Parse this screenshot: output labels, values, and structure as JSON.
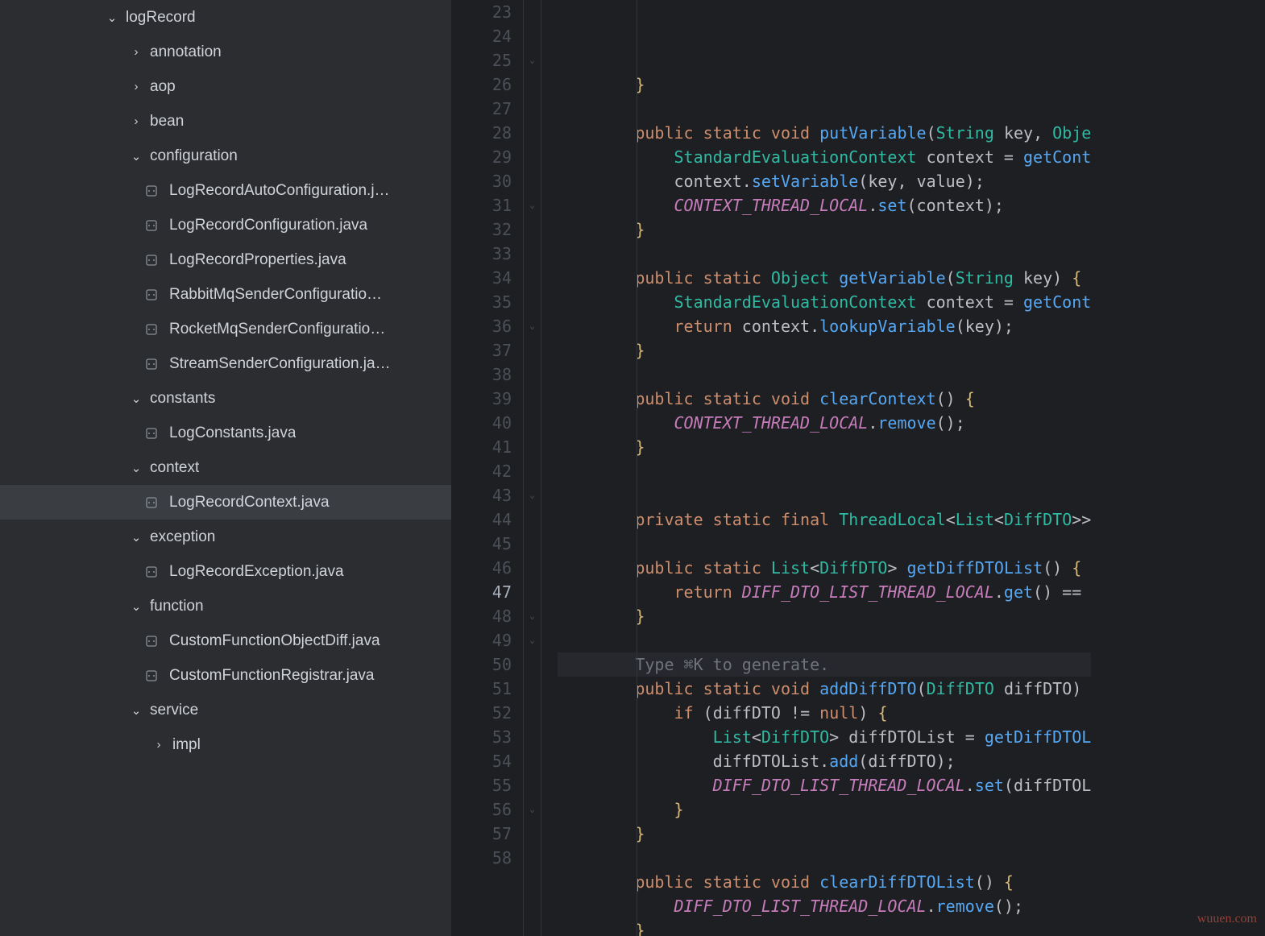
{
  "sidebar": {
    "root": "logRecord",
    "folders": {
      "annotation": "annotation",
      "aop": "aop",
      "bean": "bean",
      "configuration": "configuration",
      "constants": "constants",
      "context": "context",
      "exception": "exception",
      "function": "function",
      "service": "service",
      "impl": "impl"
    },
    "files": {
      "cfg1": "LogRecordAutoConfiguration.j…",
      "cfg2": "LogRecordConfiguration.java",
      "cfg3": "LogRecordProperties.java",
      "cfg4": "RabbitMqSenderConfiguratio…",
      "cfg5": "RocketMqSenderConfiguratio…",
      "cfg6": "StreamSenderConfiguration.ja…",
      "const1": "LogConstants.java",
      "ctx1": "LogRecordContext.java",
      "exc1": "LogRecordException.java",
      "fn1": "CustomFunctionObjectDiff.java",
      "fn2": "CustomFunctionRegistrar.java"
    }
  },
  "editor": {
    "lines_start": 23,
    "lines_end": 58,
    "current_line": 47,
    "foldable": [
      25,
      31,
      36,
      43,
      48,
      49,
      56
    ],
    "hint_text": "Type ⌘K to generate.",
    "code": [
      [
        [
          "curly",
          "        }"
        ]
      ],
      [],
      [
        [
          "ws",
          "        "
        ],
        [
          "kw",
          "public"
        ],
        [
          "ws",
          " "
        ],
        [
          "kw",
          "static"
        ],
        [
          "ws",
          " "
        ],
        [
          "kw",
          "void"
        ],
        [
          "ws",
          " "
        ],
        [
          "m",
          "putVariable"
        ],
        [
          "p",
          "("
        ],
        [
          "cls",
          "String"
        ],
        [
          "ws",
          " "
        ],
        [
          "id",
          "key"
        ],
        [
          "p",
          ", "
        ],
        [
          "cls",
          "Obje"
        ]
      ],
      [
        [
          "ws",
          "            "
        ],
        [
          "cls",
          "StandardEvaluationContext"
        ],
        [
          "ws",
          " "
        ],
        [
          "id",
          "context"
        ],
        [
          "ws",
          " "
        ],
        [
          "p",
          "="
        ],
        [
          "ws",
          " "
        ],
        [
          "m",
          "getCont"
        ]
      ],
      [
        [
          "ws",
          "            "
        ],
        [
          "id",
          "context"
        ],
        [
          "p",
          "."
        ],
        [
          "m",
          "setVariable"
        ],
        [
          "p",
          "("
        ],
        [
          "id",
          "key"
        ],
        [
          "p",
          ", "
        ],
        [
          "id",
          "value"
        ],
        [
          "p",
          ");"
        ]
      ],
      [
        [
          "ws",
          "            "
        ],
        [
          "cnst",
          "CONTEXT_THREAD_LOCAL"
        ],
        [
          "p",
          "."
        ],
        [
          "m",
          "set"
        ],
        [
          "p",
          "("
        ],
        [
          "id",
          "context"
        ],
        [
          "p",
          ");"
        ]
      ],
      [
        [
          "ws",
          "        "
        ],
        [
          "curly",
          "}"
        ]
      ],
      [],
      [
        [
          "ws",
          "        "
        ],
        [
          "kw",
          "public"
        ],
        [
          "ws",
          " "
        ],
        [
          "kw",
          "static"
        ],
        [
          "ws",
          " "
        ],
        [
          "cls",
          "Object"
        ],
        [
          "ws",
          " "
        ],
        [
          "m",
          "getVariable"
        ],
        [
          "p",
          "("
        ],
        [
          "cls",
          "String"
        ],
        [
          "ws",
          " "
        ],
        [
          "id",
          "key"
        ],
        [
          "p",
          ") "
        ],
        [
          "curly",
          "{"
        ]
      ],
      [
        [
          "ws",
          "            "
        ],
        [
          "cls",
          "StandardEvaluationContext"
        ],
        [
          "ws",
          " "
        ],
        [
          "id",
          "context"
        ],
        [
          "ws",
          " "
        ],
        [
          "p",
          "="
        ],
        [
          "ws",
          " "
        ],
        [
          "m",
          "getCont"
        ]
      ],
      [
        [
          "ws",
          "            "
        ],
        [
          "kw",
          "return"
        ],
        [
          "ws",
          " "
        ],
        [
          "id",
          "context"
        ],
        [
          "p",
          "."
        ],
        [
          "m",
          "lookupVariable"
        ],
        [
          "p",
          "("
        ],
        [
          "id",
          "key"
        ],
        [
          "p",
          ");"
        ]
      ],
      [
        [
          "ws",
          "        "
        ],
        [
          "curly",
          "}"
        ]
      ],
      [],
      [
        [
          "ws",
          "        "
        ],
        [
          "kw",
          "public"
        ],
        [
          "ws",
          " "
        ],
        [
          "kw",
          "static"
        ],
        [
          "ws",
          " "
        ],
        [
          "kw",
          "void"
        ],
        [
          "ws",
          " "
        ],
        [
          "m",
          "clearContext"
        ],
        [
          "p",
          "() "
        ],
        [
          "curly",
          "{"
        ]
      ],
      [
        [
          "ws",
          "            "
        ],
        [
          "cnst",
          "CONTEXT_THREAD_LOCAL"
        ],
        [
          "p",
          "."
        ],
        [
          "m",
          "remove"
        ],
        [
          "p",
          "();"
        ]
      ],
      [
        [
          "ws",
          "        "
        ],
        [
          "curly",
          "}"
        ]
      ],
      [],
      [],
      [
        [
          "ws",
          "        "
        ],
        [
          "kw",
          "private"
        ],
        [
          "ws",
          " "
        ],
        [
          "kw",
          "static"
        ],
        [
          "ws",
          " "
        ],
        [
          "kw",
          "final"
        ],
        [
          "ws",
          " "
        ],
        [
          "cls",
          "ThreadLocal"
        ],
        [
          "p",
          "<"
        ],
        [
          "cls",
          "List"
        ],
        [
          "p",
          "<"
        ],
        [
          "cls",
          "DiffDTO"
        ],
        [
          "p",
          ">>"
        ]
      ],
      [],
      [
        [
          "ws",
          "        "
        ],
        [
          "kw",
          "public"
        ],
        [
          "ws",
          " "
        ],
        [
          "kw",
          "static"
        ],
        [
          "ws",
          " "
        ],
        [
          "cls",
          "List"
        ],
        [
          "p",
          "<"
        ],
        [
          "cls",
          "DiffDTO"
        ],
        [
          "p",
          "> "
        ],
        [
          "m",
          "getDiffDTOList"
        ],
        [
          "p",
          "() "
        ],
        [
          "curly",
          "{"
        ]
      ],
      [
        [
          "ws",
          "            "
        ],
        [
          "kw",
          "return"
        ],
        [
          "ws",
          " "
        ],
        [
          "cnst",
          "DIFF_DTO_LIST_THREAD_LOCAL"
        ],
        [
          "p",
          "."
        ],
        [
          "m",
          "get"
        ],
        [
          "p",
          "() "
        ],
        [
          "p",
          "=="
        ]
      ],
      [
        [
          "ws",
          "        "
        ],
        [
          "curly",
          "}"
        ]
      ],
      [],
      [
        [
          "hint",
          "        Type ⌘K to generate."
        ]
      ],
      [
        [
          "ws",
          "        "
        ],
        [
          "kw",
          "public"
        ],
        [
          "ws",
          " "
        ],
        [
          "kw",
          "static"
        ],
        [
          "ws",
          " "
        ],
        [
          "kw",
          "void"
        ],
        [
          "ws",
          " "
        ],
        [
          "m",
          "addDiffDTO"
        ],
        [
          "p",
          "("
        ],
        [
          "cls",
          "DiffDTO"
        ],
        [
          "ws",
          " "
        ],
        [
          "id",
          "diffDTO"
        ],
        [
          "p",
          ")"
        ]
      ],
      [
        [
          "ws",
          "            "
        ],
        [
          "kw",
          "if"
        ],
        [
          "ws",
          " "
        ],
        [
          "p",
          "("
        ],
        [
          "id",
          "diffDTO"
        ],
        [
          "ws",
          " "
        ],
        [
          "p",
          "!="
        ],
        [
          "ws",
          " "
        ],
        [
          "nl",
          "null"
        ],
        [
          "p",
          ") "
        ],
        [
          "curly",
          "{"
        ]
      ],
      [
        [
          "ws",
          "                "
        ],
        [
          "cls",
          "List"
        ],
        [
          "p",
          "<"
        ],
        [
          "cls",
          "DiffDTO"
        ],
        [
          "p",
          "> "
        ],
        [
          "id",
          "diffDTOList"
        ],
        [
          "ws",
          " "
        ],
        [
          "p",
          "="
        ],
        [
          "ws",
          " "
        ],
        [
          "m",
          "getDiffDTOL"
        ]
      ],
      [
        [
          "ws",
          "                "
        ],
        [
          "id",
          "diffDTOList"
        ],
        [
          "p",
          "."
        ],
        [
          "m",
          "add"
        ],
        [
          "p",
          "("
        ],
        [
          "id",
          "diffDTO"
        ],
        [
          "p",
          ");"
        ]
      ],
      [
        [
          "ws",
          "                "
        ],
        [
          "cnst",
          "DIFF_DTO_LIST_THREAD_LOCAL"
        ],
        [
          "p",
          "."
        ],
        [
          "m",
          "set"
        ],
        [
          "p",
          "("
        ],
        [
          "id",
          "diffDTOL"
        ]
      ],
      [
        [
          "ws",
          "            "
        ],
        [
          "curly",
          "}"
        ]
      ],
      [
        [
          "ws",
          "        "
        ],
        [
          "curly",
          "}"
        ]
      ],
      [],
      [
        [
          "ws",
          "        "
        ],
        [
          "kw",
          "public"
        ],
        [
          "ws",
          " "
        ],
        [
          "kw",
          "static"
        ],
        [
          "ws",
          " "
        ],
        [
          "kw",
          "void"
        ],
        [
          "ws",
          " "
        ],
        [
          "m",
          "clearDiffDTOList"
        ],
        [
          "p",
          "() "
        ],
        [
          "curly",
          "{"
        ]
      ],
      [
        [
          "ws",
          "            "
        ],
        [
          "cnst",
          "DIFF_DTO_LIST_THREAD_LOCAL"
        ],
        [
          "p",
          "."
        ],
        [
          "m",
          "remove"
        ],
        [
          "p",
          "();"
        ]
      ],
      [
        [
          "ws",
          "        "
        ],
        [
          "curly",
          "}"
        ]
      ]
    ]
  },
  "watermark": "wuuen.com"
}
